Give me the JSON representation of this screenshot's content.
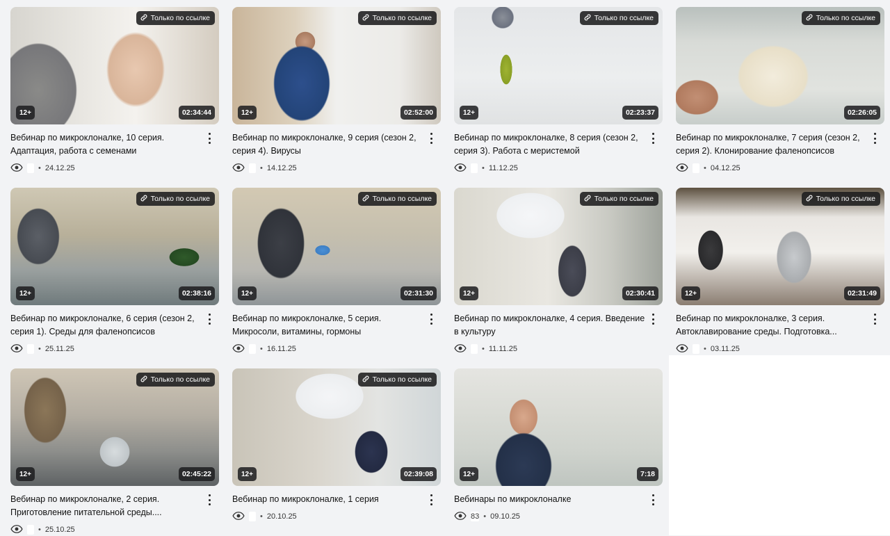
{
  "link_badge_label": "Только по ссылке",
  "age_label": "12+",
  "videos": [
    {
      "title": "Вебинар по микроклоналке, 10 серия. Адаптация, работа с семенами",
      "duration": "02:34:44",
      "views": "",
      "date": "24.12.25",
      "link_only": true,
      "age": true
    },
    {
      "title": "Вебинар по микроклоналке, 9 серия (сезон 2, серия 4). Вирусы",
      "duration": "02:52:00",
      "views": "",
      "date": "14.12.25",
      "link_only": true,
      "age": true
    },
    {
      "title": "Вебинар по микроклоналке, 8 серия (сезон 2, серия 3). Работа с меристемой",
      "duration": "02:23:37",
      "views": "",
      "date": "11.12.25",
      "link_only": true,
      "age": true
    },
    {
      "title": "Вебинар по микроклоналке, 7 серия (сезон 2, серия 2). Клонирование фаленопсисов",
      "duration": "02:26:05",
      "views": "",
      "date": "04.12.25",
      "link_only": true,
      "age": false
    },
    {
      "title": "Вебинар по микроклоналке, 6 серия (сезон 2, серия 1). Среды для фаленопсисов",
      "duration": "02:38:16",
      "views": "",
      "date": "25.11.25",
      "link_only": true,
      "age": true
    },
    {
      "title": "Вебинар по микроклоналке, 5 серия. Микросоли, витамины, гормоны",
      "duration": "02:31:30",
      "views": "",
      "date": "16.11.25",
      "link_only": true,
      "age": true
    },
    {
      "title": "Вебинар по микроклоналке, 4 серия. Введение в культуру",
      "duration": "02:30:41",
      "views": "",
      "date": "11.11.25",
      "link_only": true,
      "age": true
    },
    {
      "title": "Вебинар по микроклоналке, 3 серия. Автоклавирование среды. Подготовка...",
      "duration": "02:31:49",
      "views": "",
      "date": "03.11.25",
      "link_only": true,
      "age": true
    },
    {
      "title": "Вебинар по микроклоналке, 2 серия. Приготовление питательной среды....",
      "duration": "02:45:22",
      "views": "",
      "date": "25.10.25",
      "link_only": true,
      "age": true
    },
    {
      "title": "Вебинар по микроклоналке, 1 серия",
      "duration": "02:39:08",
      "views": "",
      "date": "20.10.25",
      "link_only": true,
      "age": true
    },
    {
      "title": "Вебинары по микроклоналке",
      "duration": "7:18",
      "views": "83",
      "date": "09.10.25",
      "link_only": false,
      "age": true
    }
  ],
  "colors": {
    "badge_bg": "#1c1c1e",
    "page_bg": "#f2f3f5",
    "text": "#111111"
  }
}
